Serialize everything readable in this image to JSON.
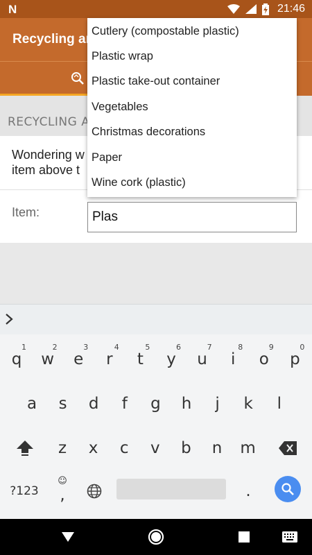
{
  "status_bar": {
    "time": "21:46",
    "icons": [
      "n-logo-icon",
      "wifi-icon",
      "signal-icon",
      "battery-charging-icon"
    ]
  },
  "app_bar": {
    "title": "Recycling an"
  },
  "tabs": {
    "icons": [
      "recycle-search-icon"
    ]
  },
  "section": {
    "header": "RECYCLING A"
  },
  "intro": {
    "text": "Wondering w\nitem above t"
  },
  "form": {
    "item_label": "Item:",
    "item_value": "Plas"
  },
  "dropdown": {
    "options": [
      "Cutlery (compostable plastic)",
      "Plastic wrap",
      "Plastic take-out container",
      "Vegetables",
      "Christmas decorations",
      "Paper",
      "Wine cork (plastic)"
    ]
  },
  "keyboard": {
    "row1": [
      {
        "key": "q",
        "hint": "1"
      },
      {
        "key": "w",
        "hint": "2"
      },
      {
        "key": "e",
        "hint": "3"
      },
      {
        "key": "r",
        "hint": "4"
      },
      {
        "key": "t",
        "hint": "5"
      },
      {
        "key": "y",
        "hint": "6"
      },
      {
        "key": "u",
        "hint": "7"
      },
      {
        "key": "i",
        "hint": "8"
      },
      {
        "key": "o",
        "hint": "9"
      },
      {
        "key": "p",
        "hint": "0"
      }
    ],
    "row2": [
      "a",
      "s",
      "d",
      "f",
      "g",
      "h",
      "j",
      "k",
      "l"
    ],
    "row3": [
      "z",
      "x",
      "c",
      "v",
      "b",
      "n",
      "m"
    ],
    "symbols_label": "?123",
    "comma_label": ",",
    "period_label": "."
  },
  "nav_bar": {
    "icons": [
      "back-icon",
      "home-icon",
      "recents-icon",
      "keyboard-switch-icon"
    ]
  },
  "colors": {
    "status_bar": "#a8541a",
    "app_bar": "#c46a2c",
    "accent": "#f5a623",
    "search_key": "#4a8df0"
  }
}
